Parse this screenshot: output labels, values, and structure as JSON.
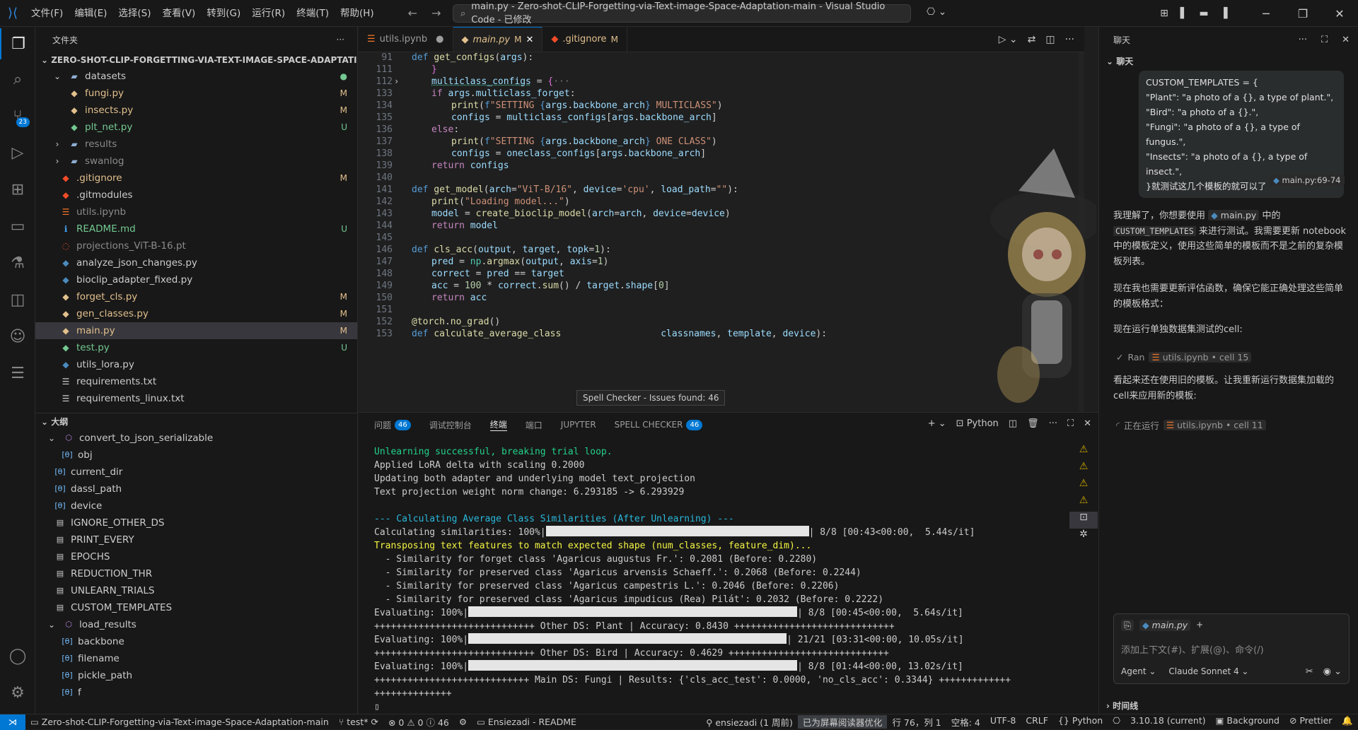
{
  "titlebar": {
    "menus": [
      "文件(F)",
      "编辑(E)",
      "选择(S)",
      "查看(V)",
      "转到(G)",
      "运行(R)",
      "终端(T)",
      "帮助(H)"
    ],
    "search": "main.py - Zero-shot-CLIP-Forgetting-via-Text-image-Space-Adaptation-main - Visual Studio Code - 已修改"
  },
  "activity": {
    "scm_badge": "23"
  },
  "explorer": {
    "header": "文件夹",
    "project": "ZERO-SHOT-CLIP-FORGETTING-VIA-TEXT-IMAGE-SPACE-ADAPTATION-M...",
    "items": [
      {
        "name": "datasets",
        "status": ""
      },
      {
        "name": "fungi.py",
        "status": "M"
      },
      {
        "name": "insects.py",
        "status": "M"
      },
      {
        "name": "plt_net.py",
        "status": "U"
      },
      {
        "name": "results",
        "status": ""
      },
      {
        "name": "swanlog",
        "status": ""
      },
      {
        "name": ".gitignore",
        "status": "M"
      },
      {
        "name": ".gitmodules",
        "status": ""
      },
      {
        "name": "utils.ipynb",
        "status": ""
      },
      {
        "name": "README.md",
        "status": "U"
      },
      {
        "name": "projections_ViT-B-16.pt",
        "status": ""
      },
      {
        "name": "analyze_json_changes.py",
        "status": ""
      },
      {
        "name": "bioclip_adapter_fixed.py",
        "status": ""
      },
      {
        "name": "forget_cls.py",
        "status": "M"
      },
      {
        "name": "gen_classes.py",
        "status": "M"
      },
      {
        "name": "main.py",
        "status": "M"
      },
      {
        "name": "test.py",
        "status": "U"
      },
      {
        "name": "utils_lora.py",
        "status": ""
      },
      {
        "name": "requirements.txt",
        "status": ""
      },
      {
        "name": "requirements_linux.txt",
        "status": ""
      }
    ]
  },
  "outline": {
    "header": "大纲",
    "items": [
      "convert_to_json_serializable",
      "obj",
      "current_dir",
      "dassl_path",
      "device",
      "IGNORE_OTHER_DS",
      "PRINT_EVERY",
      "EPOCHS",
      "REDUCTION_THR",
      "UNLEARN_TRIALS",
      "CUSTOM_TEMPLATES",
      "load_results",
      "backbone",
      "filename",
      "pickle_path",
      "f"
    ]
  },
  "tabs": [
    {
      "label": "utils.ipynb",
      "state": "●"
    },
    {
      "label": "main.py",
      "state": "M"
    },
    {
      "label": ".gitignore",
      "state": "M"
    }
  ],
  "code": {
    "line_numbers": [
      "91",
      "111",
      "112",
      "133",
      "134",
      "135",
      "136",
      "137",
      "138",
      "139",
      "140",
      "141",
      "142",
      "143",
      "144",
      "145",
      "146",
      "147",
      "148",
      "149",
      "150",
      "151",
      "152",
      "153"
    ],
    "hover": "Spell Checker - Issues found: 46"
  },
  "panel": {
    "tabs": [
      "问题",
      "调试控制台",
      "终端",
      "端口",
      "JUPYTER",
      "SPELL CHECKER"
    ],
    "problems_count": "46",
    "spell_count": "46",
    "shell": "Python",
    "lines": [
      "Unlearning successful, breaking trial loop.",
      "Applied LoRA delta with scaling 0.2000",
      "Updating both adapter and underlying model text_projection",
      "Text projection weight norm change: 6.293185 -> 6.293929",
      "",
      "--- Calculating Average Class Similarities (After Unlearning) ---",
      "Calculating similarities: 100%|",
      "Transposing text features to match expected shape (num_classes, feature_dim)...",
      "  - Similarity for forget class 'Agaricus augustus Fr.': 0.2081 (Before: 0.2280)",
      "  - Similarity for preserved class 'Agaricus arvensis Schaeff.': 0.2068 (Before: 0.2244)",
      "  - Similarity for preserved class 'Agaricus campestris L.': 0.2046 (Before: 0.2206)",
      "  - Similarity for preserved class 'Agaricus impudicus (Rea) Pilát': 0.2032 (Before: 0.2222)",
      "Evaluating: 100%|",
      "+++++++++++++++++++++++++++++ Other DS: Plant | Accuracy: 0.8430 +++++++++++++++++++++++++++++",
      "Evaluating: 100%|",
      "+++++++++++++++++++++++++++++ Other DS: Bird | Accuracy: 0.4629 +++++++++++++++++++++++++++++",
      "Evaluating: 100%|",
      "++++++++++++++++++++++++++++ Main DS: Fungi | Results: {'cls_acc_test': 0.0000, 'no_cls_acc': 0.3344} +++++++++++++",
      "++++++++++++++"
    ],
    "progress_suffix": [
      "| 8/8 [00:43<00:00,  5.44s/it]",
      "| 8/8 [00:45<00:00,  5.64s/it]",
      "| 21/21 [03:31<00:00, 10.05s/it]",
      "| 8/8 [01:44<00:00, 13.02s/it]"
    ]
  },
  "chat": {
    "title": "聊天",
    "section": "聊天",
    "user_lines": [
      "CUSTOM_TEMPLATES = {",
      "\"Plant\": \"a photo of a {}, a type of plant.\",",
      "\"Bird\": \"a photo of a {}.\",",
      "\"Fungi\": \"a photo of a {}, a type of fungus.\",",
      "\"Insects\": \"a photo of a {}, a type of insect.\",",
      "}就测试这几个模板的就可以了"
    ],
    "user_ref": "main.py:69-74",
    "p1a": "我理解了，你想要使用",
    "p1file": "main.py",
    "p1b": "中的",
    "p1code": "CUSTOM_TEMPLATES",
    "p1c": "来进行测试。我需要更新 notebook 中的模板定义，使用这些简单的模板而不是之前的复杂模板列表。",
    "p2": "现在我也需要更新评估函数，确保它能正确处理这些简单的模板格式：",
    "p3": "现在运行单独数据集测试的cell:",
    "ran": "Ran",
    "ran_ref": "utils.ipynb • cell 15",
    "p4": "看起来还在使用旧的模板。让我重新运行数据集加载的cell来应用新的模板:",
    "running": "正在运行",
    "running_ref": "utils.ipynb • cell 11",
    "input_file": "main.py",
    "input_placeholder": "添加上下文(#)、扩展(@)、命令(/)",
    "agent": "Agent",
    "model": "Claude Sonnet 4",
    "timeline": "时间线"
  },
  "status": {
    "branch_name": "Zero-shot-CLIP-Forgetting-via-Text-image-Space-Adaptation-main",
    "git": "test*",
    "errors": "0",
    "warnings": "0",
    "info": "46",
    "readme": "Ensiezadi - README",
    "blame": "ensiezadi (1 周前)",
    "screen_reader": "已为屏幕阅读器优化",
    "cursor": "行 76，列 1",
    "spaces": "空格: 4",
    "encoding": "UTF-8",
    "eol": "CRLF",
    "lang": "Python",
    "pyver": "3.10.18 (current)",
    "bg": "Background",
    "prettier": "Prettier"
  }
}
